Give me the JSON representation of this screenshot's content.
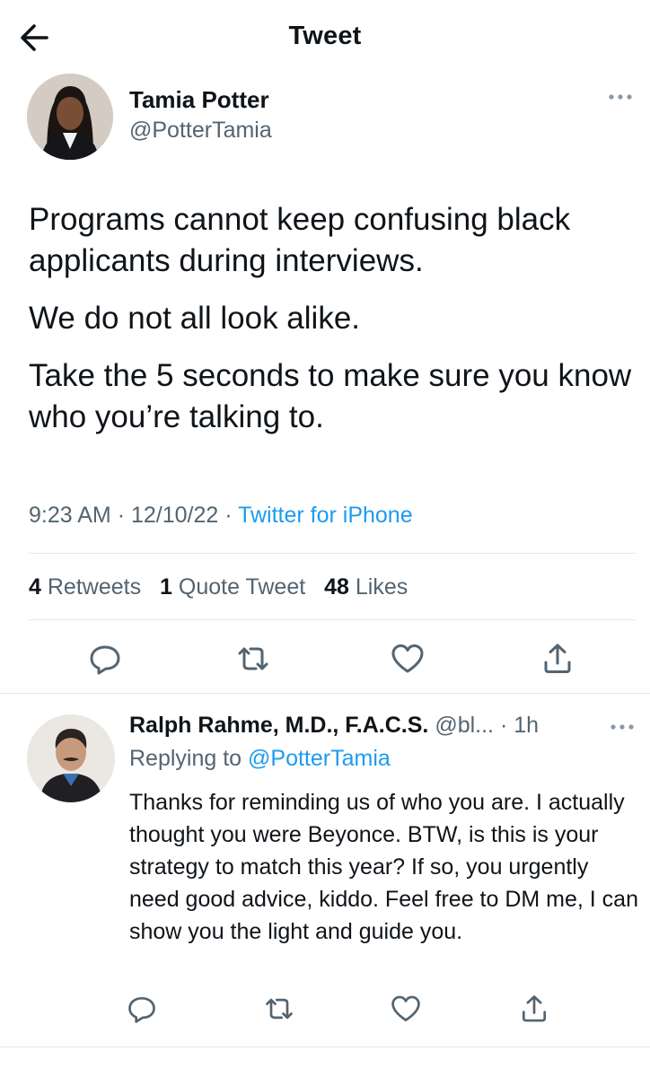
{
  "header": {
    "title": "Tweet"
  },
  "tweet": {
    "author_name": "Tamia Potter",
    "author_handle": "@PotterTamia",
    "paragraphs": [
      "Programs cannot keep confusing black applicants during interviews.",
      "We do not all look alike.",
      "Take the 5 seconds to make sure you know who you’re talking to."
    ],
    "time": "9:23 AM",
    "date": "12/10/22",
    "source": "Twitter for iPhone",
    "stats": {
      "retweets_count": "4",
      "retweets_label": "Retweets",
      "quotes_count": "1",
      "quotes_label": "Quote Tweet",
      "likes_count": "48",
      "likes_label": "Likes"
    }
  },
  "reply": {
    "author_name": "Ralph Rahme, M.D., F.A.C.S.",
    "author_handle": "@bl...",
    "time_ago": "1h",
    "replying_prefix": "Replying to",
    "replying_to": "@PotterTamia",
    "text": "Thanks for reminding us of who you are. I actually thought you were Beyonce. BTW, is this is your strategy to match this year? If so, you urgently need good advice, kiddo. Feel free to DM me, I can show you the light and guide you."
  },
  "icons": {
    "back": "arrow-left-icon",
    "more": "more-horizontal-icon",
    "reply": "reply-icon",
    "retweet": "retweet-icon",
    "like": "heart-icon",
    "share": "share-icon"
  },
  "colors": {
    "text": "#0f1419",
    "secondary": "#536471",
    "accent": "#1d9bf0",
    "divider": "#e6e9ec"
  }
}
